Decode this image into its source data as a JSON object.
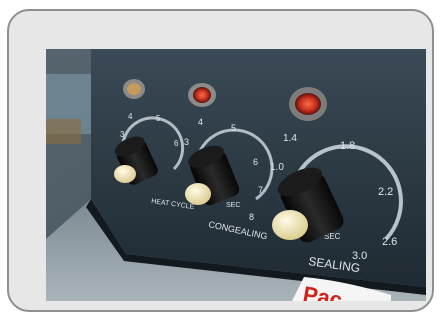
{
  "photo": {
    "description_icon": "panel-photo-icon",
    "labels": {
      "left_knob_numbers": [
        "4",
        "5",
        "6",
        "3"
      ],
      "left_knob_label": "HEAT CYCLE",
      "mid_knob_numbers": [
        "3",
        "4",
        "5",
        "6",
        "7",
        "8"
      ],
      "mid_knob_label": "CONGEALING",
      "mid_knob_unit": "SEC",
      "right_knob_numbers": [
        "1.4",
        "1.8",
        "2.2",
        "2.6",
        "3.0",
        "1.0"
      ],
      "right_knob_label": "SEALING",
      "right_knob_unit": "SEC",
      "brand_fragment": "Pac"
    }
  },
  "colors": {
    "card_bg": "#e7e7e7",
    "card_border": "#8f8f8f",
    "panel": "#2a3842",
    "dial_ring": "#c8d2da",
    "lamp_red": "#c4301f",
    "knob_cap": "#f0e6b8",
    "brand_red": "#d0221a"
  }
}
